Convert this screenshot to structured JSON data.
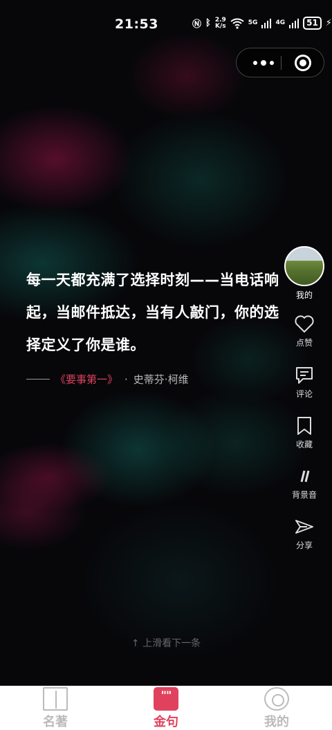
{
  "status_bar": {
    "time": "21:53",
    "net_speed_top": "2.9",
    "net_speed_unit": "K/s",
    "signal_label": "5G",
    "signal_label2": "4G",
    "battery": "51"
  },
  "quote": {
    "text": "每一天都充满了选择时刻——当电话响起，当邮件抵达，当有人敲门，你的选择定义了你是谁。",
    "book": "《要事第一》",
    "separator": "·",
    "author": "史蒂芬·柯维"
  },
  "side_actions": {
    "me_label": "我的",
    "like_label": "点赞",
    "comment_label": "评论",
    "favorite_label": "收藏",
    "bgm_label": "背景音",
    "share_label": "分享"
  },
  "hint": "↑ 上滑看下一条",
  "tabs": [
    {
      "label": "名著",
      "icon": "book-icon"
    },
    {
      "label": "金句",
      "icon": "quote-icon",
      "active": true
    },
    {
      "label": "我的",
      "icon": "profile-icon"
    }
  ],
  "colors": {
    "accent": "#e0425e",
    "background": "#07070a"
  }
}
